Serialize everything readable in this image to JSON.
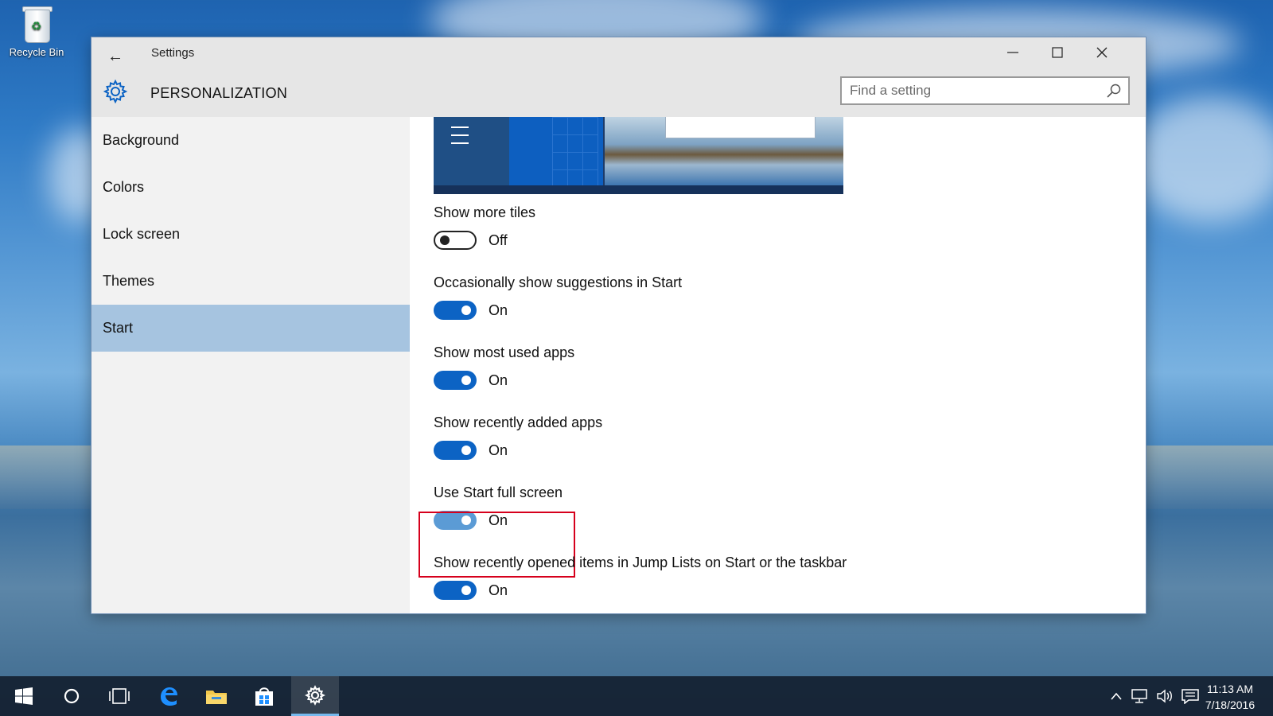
{
  "desktop": {
    "recycle_bin_label": "Recycle Bin"
  },
  "window": {
    "app_title": "Settings",
    "section_title": "PERSONALIZATION",
    "search": {
      "placeholder": "Find a setting",
      "value": ""
    }
  },
  "sidebar": {
    "items": [
      {
        "label": "Background",
        "active": false
      },
      {
        "label": "Colors",
        "active": false
      },
      {
        "label": "Lock screen",
        "active": false
      },
      {
        "label": "Themes",
        "active": false
      },
      {
        "label": "Start",
        "active": true
      }
    ]
  },
  "settings": [
    {
      "label": "Show more tiles",
      "state": "Off"
    },
    {
      "label": "Occasionally show suggestions in Start",
      "state": "On"
    },
    {
      "label": "Show most used apps",
      "state": "On"
    },
    {
      "label": "Show recently added apps",
      "state": "On"
    },
    {
      "label": "Use Start full screen",
      "state": "On",
      "highlighted": true
    },
    {
      "label": "Show recently opened items in Jump Lists on Start or the taskbar",
      "state": "On"
    }
  ],
  "taskbar": {
    "clock_time": "11:13 AM",
    "clock_date": "7/18/2016",
    "pinned": [
      "start-icon",
      "cortana-icon",
      "task-view-icon",
      "edge-icon",
      "file-explorer-icon",
      "store-icon",
      "settings-icon"
    ],
    "active_app": "settings-icon",
    "accent_color": "#0c63c4",
    "highlight_color": "#d6001c"
  }
}
